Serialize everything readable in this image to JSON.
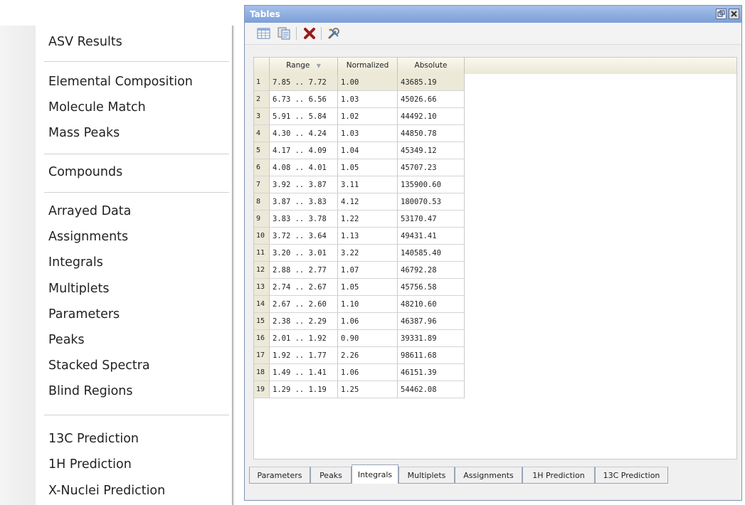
{
  "menu": {
    "items": [
      "ASV Results",
      "Elemental Composition",
      "Molecule Match",
      "Mass Peaks",
      "Compounds",
      "Arrayed Data",
      "Assignments",
      "Integrals",
      "Multiplets",
      "Parameters",
      "Peaks",
      "Stacked Spectra",
      "Blind Regions",
      "13C Prediction",
      "1H Prediction",
      "X-Nuclei Prediction"
    ]
  },
  "panel": {
    "title": "Tables",
    "restore_icon": "restore-window-icon",
    "close_icon": "close-window-icon",
    "toolbar_icons": [
      "table-view-icon",
      "copy-table-icon",
      "delete-icon",
      "settings-wrench-icon"
    ],
    "columns": [
      "Range",
      "Normalized",
      "Absolute"
    ],
    "sort_indicator": "▼",
    "rows": [
      {
        "n": "1",
        "range": "7.85 .. 7.72",
        "normalized": "1.00",
        "absolute": "43685.19"
      },
      {
        "n": "2",
        "range": "6.73 .. 6.56",
        "normalized": "1.03",
        "absolute": "45026.66"
      },
      {
        "n": "3",
        "range": "5.91 .. 5.84",
        "normalized": "1.02",
        "absolute": "44492.10"
      },
      {
        "n": "4",
        "range": "4.30 .. 4.24",
        "normalized": "1.03",
        "absolute": "44850.78"
      },
      {
        "n": "5",
        "range": "4.17 .. 4.09",
        "normalized": "1.04",
        "absolute": "45349.12"
      },
      {
        "n": "6",
        "range": "4.08 .. 4.01",
        "normalized": "1.05",
        "absolute": "45707.23"
      },
      {
        "n": "7",
        "range": "3.92 .. 3.87",
        "normalized": "3.11",
        "absolute": "135900.60"
      },
      {
        "n": "8",
        "range": "3.87 .. 3.83",
        "normalized": "4.12",
        "absolute": "180070.53"
      },
      {
        "n": "9",
        "range": "3.83 .. 3.78",
        "normalized": "1.22",
        "absolute": "53170.47"
      },
      {
        "n": "10",
        "range": "3.72 .. 3.64",
        "normalized": "1.13",
        "absolute": "49431.41"
      },
      {
        "n": "11",
        "range": "3.20 .. 3.01",
        "normalized": "3.22",
        "absolute": "140585.40"
      },
      {
        "n": "12",
        "range": "2.88 .. 2.77",
        "normalized": "1.07",
        "absolute": "46792.28"
      },
      {
        "n": "13",
        "range": "2.74 .. 2.67",
        "normalized": "1.05",
        "absolute": "45756.58"
      },
      {
        "n": "14",
        "range": "2.67 .. 2.60",
        "normalized": "1.10",
        "absolute": "48210.60"
      },
      {
        "n": "15",
        "range": "2.38 .. 2.29",
        "normalized": "1.06",
        "absolute": "46387.96"
      },
      {
        "n": "16",
        "range": "2.01 .. 1.92",
        "normalized": "0.90",
        "absolute": "39331.89"
      },
      {
        "n": "17",
        "range": "1.92 .. 1.77",
        "normalized": "2.26",
        "absolute": "98611.68"
      },
      {
        "n": "18",
        "range": "1.49 .. 1.41",
        "normalized": "1.06",
        "absolute": "46151.39"
      },
      {
        "n": "19",
        "range": "1.29 .. 1.19",
        "normalized": "1.25",
        "absolute": "54462.08"
      }
    ],
    "tabs": [
      "Parameters",
      "Peaks",
      "Integrals",
      "Multiplets",
      "Assignments",
      "1H Prediction",
      "13C Prediction"
    ],
    "active_tab": "Integrals"
  }
}
